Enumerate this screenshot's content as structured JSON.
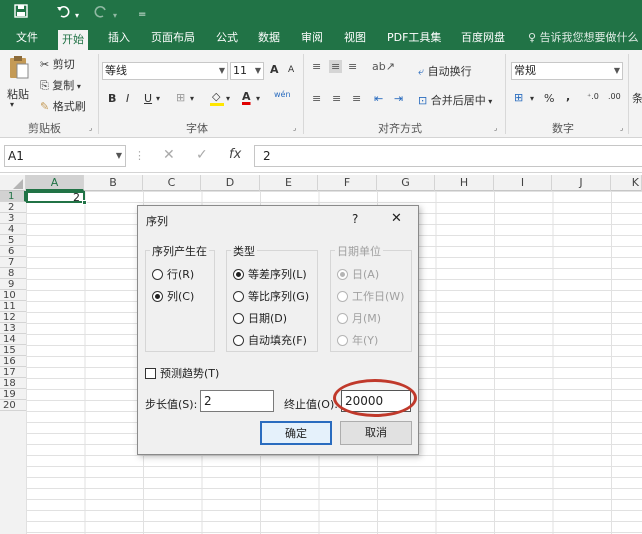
{
  "quick_access": {
    "save_icon": "save-icon",
    "undo_icon": "undo-icon",
    "redo_icon": "redo-icon",
    "customize": "="
  },
  "tabs": [
    "文件",
    "开始",
    "插入",
    "页面布局",
    "公式",
    "数据",
    "审阅",
    "视图",
    "PDF工具集",
    "百度网盘"
  ],
  "active_tab": "开始",
  "tell_me": "告诉我您想要做什么",
  "ribbon": {
    "clipboard": {
      "paste": "粘贴",
      "cut": "剪切",
      "copy": "复制",
      "format_painter": "格式刷",
      "label": "剪贴板"
    },
    "font": {
      "name": "等线",
      "size": "11",
      "grow": "A",
      "shrink": "A",
      "bold": "B",
      "italic": "I",
      "underline": "U",
      "font_color": "A",
      "phonetic": "wén",
      "label": "字体"
    },
    "alignment": {
      "wrap": "自动换行",
      "merge": "合并后居中",
      "label": "对齐方式"
    },
    "number": {
      "format": "常规",
      "percent": "%",
      "comma": ",",
      "label": "数字"
    },
    "cond": "条"
  },
  "formula_bar": {
    "name_box": "A1",
    "fx": "fx",
    "value": "2"
  },
  "columns": [
    "A",
    "B",
    "C",
    "D",
    "E",
    "F",
    "G",
    "H",
    "I",
    "J",
    "K"
  ],
  "rows": [
    "1",
    "2",
    "3",
    "4",
    "5",
    "6",
    "7",
    "8",
    "9",
    "10",
    "11",
    "12",
    "13",
    "14",
    "15",
    "16",
    "17",
    "18",
    "19",
    "20"
  ],
  "cell_a1": "2",
  "dialog": {
    "title": "序列",
    "help": "?",
    "close": "✕",
    "series_in": {
      "label": "序列产生在",
      "rows": "行(R)",
      "cols": "列(C)"
    },
    "type": {
      "label": "类型",
      "linear": "等差序列(L)",
      "growth": "等比序列(G)",
      "date": "日期(D)",
      "autofill": "自动填充(F)"
    },
    "date_unit": {
      "label": "日期单位",
      "day": "日(A)",
      "weekday": "工作日(W)",
      "month": "月(M)",
      "year": "年(Y)"
    },
    "trend": "预测趋势(T)",
    "step_label": "步长值(S):",
    "step_value": "2",
    "stop_label": "终止值(O):",
    "stop_value": "20000",
    "ok": "确定",
    "cancel": "取消"
  },
  "colors": {
    "excel_green": "#217346",
    "highlight_circle": "#c0392b",
    "font_red": "#e00000",
    "fill_yellow": "#ffe600"
  }
}
